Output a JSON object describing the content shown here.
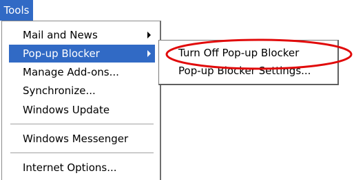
{
  "menubar": {
    "tools_label": "Tools"
  },
  "tools_menu": {
    "items": [
      {
        "label": "Mail and News"
      },
      {
        "label": "Pop-up Blocker"
      },
      {
        "label": "Manage Add-ons..."
      },
      {
        "label": "Synchronize..."
      },
      {
        "label": "Windows Update"
      },
      {
        "label": "Windows Messenger"
      },
      {
        "label": "Internet Options..."
      }
    ]
  },
  "popup_submenu": {
    "items": [
      {
        "label": "Turn Off Pop-up Blocker"
      },
      {
        "label": "Pop-up Blocker Settings..."
      }
    ]
  },
  "colors": {
    "highlight": "#316ac5",
    "annotation": "#e10a0a"
  },
  "icons": {
    "submenu_arrow": "chevron-right-icon"
  }
}
